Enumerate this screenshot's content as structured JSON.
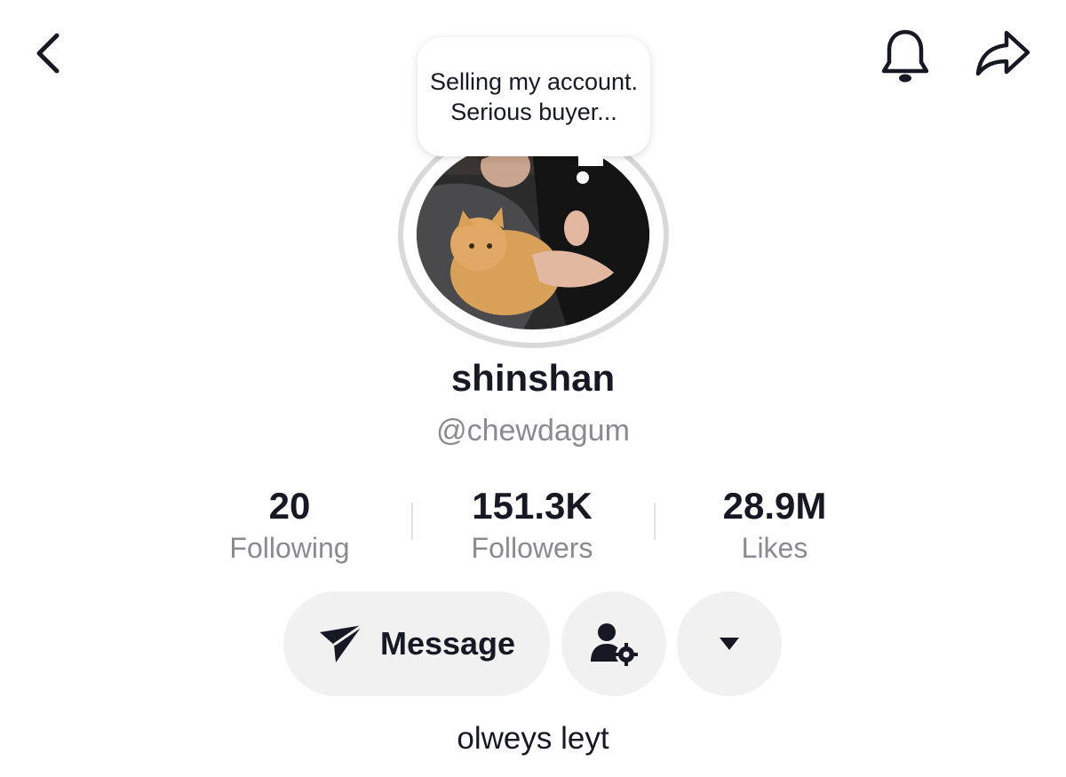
{
  "header": {
    "back_icon": "chevron-left-icon",
    "notification_icon": "bell-icon",
    "share_icon": "share-arrow-icon"
  },
  "profile": {
    "note": "Selling my account. Serious buyer...",
    "display_name": "shinshan",
    "handle": "@chewdagum",
    "bio": "olweys leyt"
  },
  "stats": [
    {
      "value": "20",
      "label": "Following"
    },
    {
      "value": "151.3K",
      "label": "Followers"
    },
    {
      "value": "28.9M",
      "label": "Likes"
    }
  ],
  "actions": {
    "message_label": "Message",
    "message_icon": "paper-plane-icon",
    "user_settings_icon": "user-gear-icon",
    "more_icon": "caret-down-icon"
  },
  "colors": {
    "text_primary": "#161823",
    "text_secondary": "#8a8b91",
    "button_bg": "#f1f1f2",
    "avatar_ring": "#d9d9d9"
  }
}
